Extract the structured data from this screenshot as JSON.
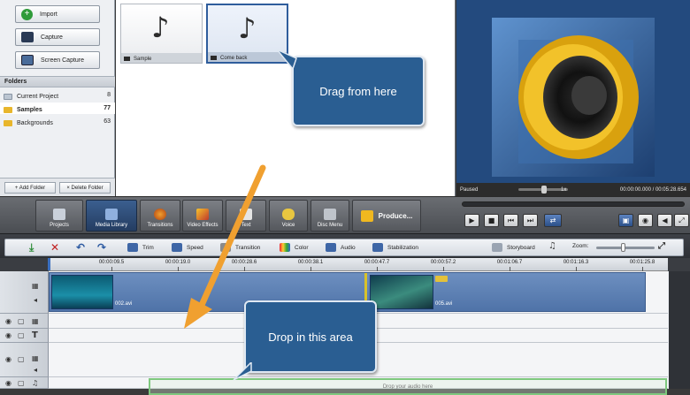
{
  "left_panel": {
    "buttons": [
      {
        "label": "Import",
        "icon": "import-icon"
      },
      {
        "label": "Capture",
        "icon": "capture-icon"
      },
      {
        "label": "Screen Capture",
        "icon": "screen-capture-icon"
      }
    ],
    "folders_title": "Folders",
    "folders": [
      {
        "label": "Current Project",
        "count": "8"
      },
      {
        "label": "Samples",
        "count": "77",
        "selected": true
      },
      {
        "label": "Backgrounds",
        "count": "63"
      }
    ],
    "add_folder": "+ Add Folder",
    "delete_folder": "× Delete Folder"
  },
  "media": {
    "items": [
      {
        "label": "Sample",
        "icon": "music-note-icon"
      },
      {
        "label": "Come back",
        "icon": "music-note-icon",
        "selected": true
      }
    ]
  },
  "callouts": {
    "drag": "Drag from here",
    "drop": "Drop in this area"
  },
  "preview": {
    "status": "Paused",
    "speed": "1x",
    "time": "00:00:00.000 / 00:05:28.654"
  },
  "toolbar": {
    "tools": [
      {
        "label": "Projects",
        "icon": "projects-icon"
      },
      {
        "label": "Media Library",
        "icon": "media-library-icon",
        "active": true
      },
      {
        "label": "Transitions",
        "icon": "transitions-icon"
      },
      {
        "label": "Video Effects",
        "icon": "video-effects-icon"
      },
      {
        "label": "Text",
        "icon": "text-icon"
      },
      {
        "label": "Voice",
        "icon": "microphone-icon"
      },
      {
        "label": "Disc Menu",
        "icon": "disc-menu-icon"
      }
    ],
    "produce": "Produce..."
  },
  "timeline_toolbar": {
    "items": [
      "Trim",
      "Speed",
      "Transition",
      "Color",
      "Audio",
      "Stabilization"
    ],
    "storyboard": "Storyboard",
    "zoom": "Zoom:"
  },
  "ruler": {
    "ticks": [
      "00:00:09.5",
      "00:00:19.0",
      "00:00:28.6",
      "00:00:38.1",
      "00:00:47.7",
      "00:00:57.2",
      "00:01:06.7",
      "00:01:16.3",
      "00:01:25.8"
    ]
  },
  "timeline": {
    "clips": [
      "002.avi",
      "005.avi"
    ],
    "drop_text": "Drop your audio here"
  },
  "colors": {
    "accent": "#2a5e92",
    "active_tool": "#2f5487",
    "drop_zone": "#7ec87e",
    "arrow": "#f0a030"
  }
}
